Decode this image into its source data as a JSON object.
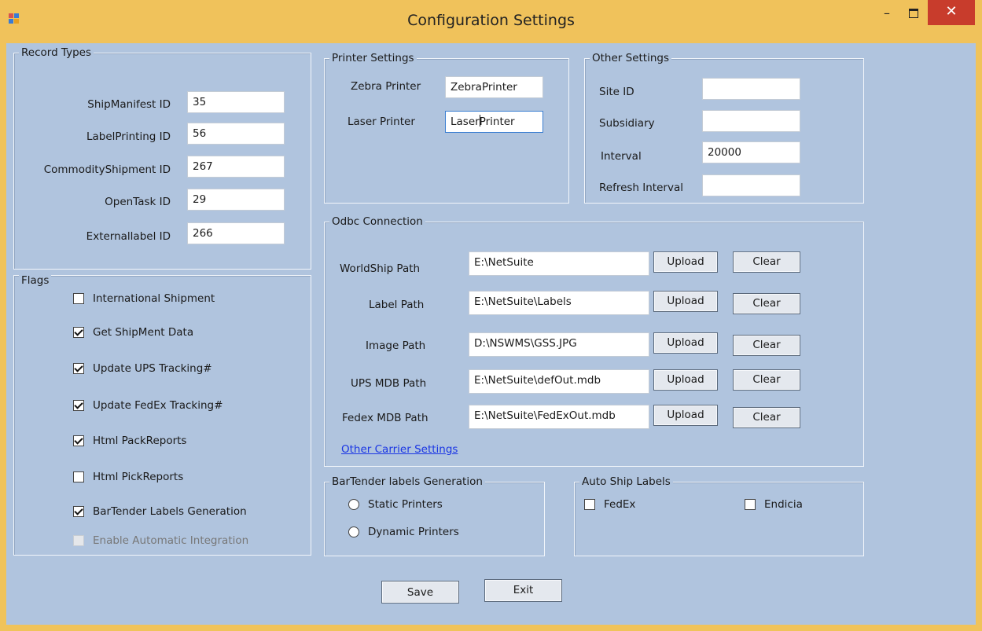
{
  "window": {
    "title": "Configuration Settings",
    "minimize_glyph": "–",
    "close_glyph": "✕",
    "icon": "app-form-icon"
  },
  "record_types": {
    "title": "Record Types",
    "fields": [
      {
        "label": "ShipManifest ID",
        "value": "35"
      },
      {
        "label": "LabelPrinting ID",
        "value": "56"
      },
      {
        "label": "CommodityShipment ID",
        "value": "267"
      },
      {
        "label": "OpenTask ID",
        "value": "29"
      },
      {
        "label": "Externallabel ID",
        "value": "266"
      }
    ]
  },
  "flags": {
    "title": "Flags",
    "items": [
      {
        "label": "International Shipment",
        "checked": false,
        "enabled": true
      },
      {
        "label": "Get ShipMent Data",
        "checked": true,
        "enabled": true
      },
      {
        "label": "Update UPS Tracking#",
        "checked": true,
        "enabled": true
      },
      {
        "label": "Update FedEx Tracking#",
        "checked": true,
        "enabled": true
      },
      {
        "label": "Html PackReports",
        "checked": true,
        "enabled": true
      },
      {
        "label": "Html PickReports",
        "checked": false,
        "enabled": true
      },
      {
        "label": "BarTender Labels Generation",
        "checked": true,
        "enabled": true
      },
      {
        "label": "Enable Automatic Integration",
        "checked": false,
        "enabled": false
      }
    ]
  },
  "printer_settings": {
    "title": "Printer Settings",
    "zebra_label": "Zebra Printer",
    "zebra_value": "ZebraPrinter",
    "laser_label": "Laser Printer",
    "laser_value_before_caret": "Laser",
    "laser_value_after_caret": "Printer"
  },
  "other_settings": {
    "title": "Other Settings",
    "fields": [
      {
        "label": "Site ID",
        "value": ""
      },
      {
        "label": "Subsidiary",
        "value": ""
      },
      {
        "label": "Interval",
        "value": "20000"
      },
      {
        "label": "Refresh Interval",
        "value": ""
      }
    ]
  },
  "odbc": {
    "title": "Odbc Connection",
    "upload_label": "Upload",
    "clear_label": "Clear",
    "paths": [
      {
        "label": "WorldShip Path",
        "value": "E:\\NetSuite"
      },
      {
        "label": "Label Path",
        "value": "E:\\NetSuite\\Labels"
      },
      {
        "label": "Image Path",
        "value": "D:\\NSWMS\\GSS.JPG"
      },
      {
        "label": "UPS MDB Path",
        "value": "E:\\NetSuite\\defOut.mdb"
      },
      {
        "label": "Fedex MDB Path",
        "value": "E:\\NetSuite\\FedExOut.mdb"
      }
    ],
    "link": "Other Carrier Settings"
  },
  "bartender": {
    "title": "BarTender labels Generation",
    "options": [
      {
        "label": "Static Printers",
        "selected": false
      },
      {
        "label": "Dynamic Printers",
        "selected": false
      }
    ]
  },
  "auto_ship": {
    "title": "Auto Ship Labels",
    "options": [
      {
        "label": "FedEx",
        "checked": false
      },
      {
        "label": "Endicia",
        "checked": false
      }
    ]
  },
  "footer": {
    "save_label": "Save",
    "exit_label": "Exit"
  }
}
